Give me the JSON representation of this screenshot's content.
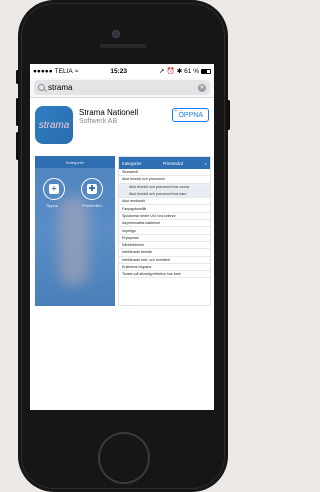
{
  "statusbar": {
    "carrier": "TELIA",
    "time": "15:23",
    "battery_pct": "61 %"
  },
  "search": {
    "query": "strama"
  },
  "app": {
    "icon_text": "strama",
    "name": "Strama Nationell",
    "developer": "Softwerk AB",
    "open_button": "ÖPPNA"
  },
  "screenshot1": {
    "title": "Kategorier",
    "left_label": "Öppna",
    "right_label": "Primärvård"
  },
  "screenshot2": {
    "title": "Primärvård",
    "back": "Kategorier",
    "rows": [
      "Stresstrull",
      "Akut bronkit och pneumoni",
      "Akut bronkit och pneumoni hos vuxna",
      "Akut bronkit och pneumoni hos barn",
      "Akut mediaotit",
      "Faryngotonsillit",
      "Sjukdomar nedre UVI hos kvinnor",
      "Asymtomatisk bakteriuri",
      "Impetigo",
      "Erysipelas",
      "Sårinfektioner",
      "Infekterade bensår",
      "Infekterade katt- och hundbett",
      "Erythema migrans",
      "Tecken på allvarlig infektion hos barn"
    ]
  }
}
